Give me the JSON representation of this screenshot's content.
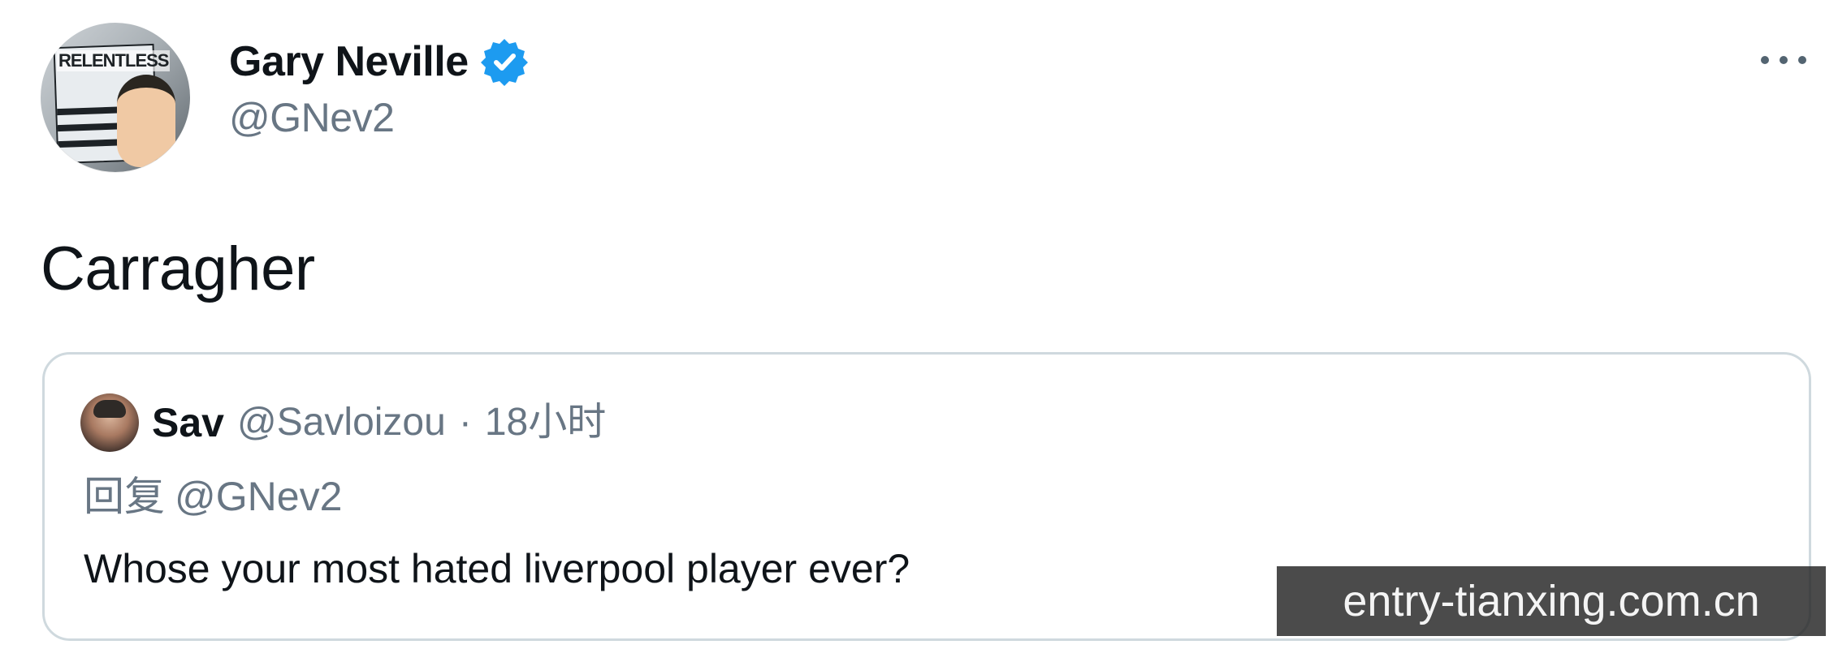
{
  "tweet": {
    "author": {
      "display_name": "Gary Neville",
      "handle": "@GNev2",
      "verified": true,
      "avatar_text": "RELENTLESS"
    },
    "text": "Carragher",
    "more_menu": {
      "icon": "more-icon"
    }
  },
  "quote": {
    "author": {
      "display_name": "Sav",
      "handle": "@Savloizou",
      "separator": "·",
      "time": "18小时"
    },
    "reply_prefix": "回复",
    "reply_to": "@GNev2",
    "text": "Whose your most hated liverpool player ever?"
  },
  "watermark": {
    "text": "entry-tianxing.com.cn"
  },
  "colors": {
    "verified_blue": "#1d9bf0",
    "secondary_text": "#687684",
    "border": "#cfd9de",
    "primary_text": "#0f1419"
  }
}
